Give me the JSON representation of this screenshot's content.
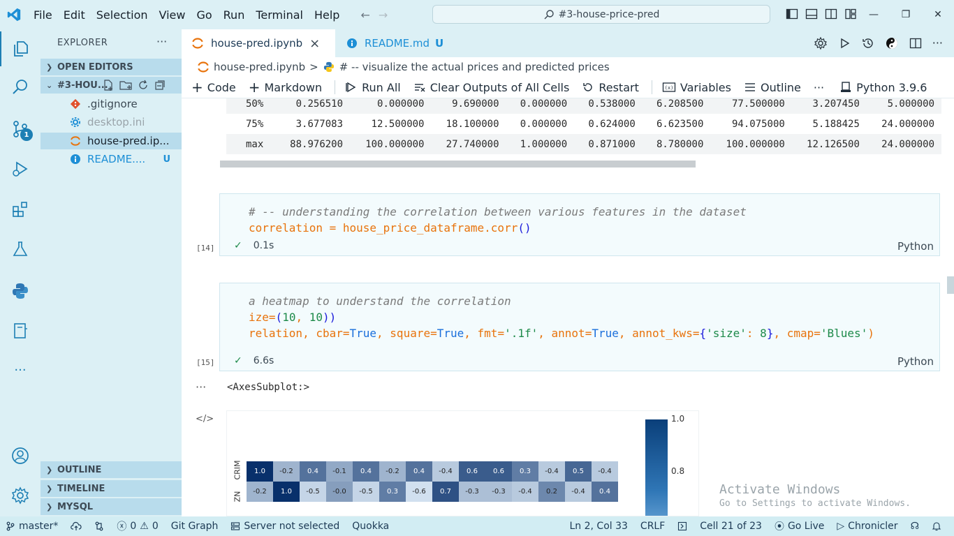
{
  "window": {
    "menu": [
      "File",
      "Edit",
      "Selection",
      "View",
      "Go",
      "Run",
      "Terminal",
      "Help"
    ],
    "search": "#3-house-price-pred"
  },
  "activity": {
    "scm_badge": "1"
  },
  "sidebar": {
    "title": "EXPLORER",
    "open_editors": "OPEN EDITORS",
    "folder": "#3-HOU...",
    "files": [
      {
        "name": ".gitignore",
        "status": ""
      },
      {
        "name": "desktop.ini",
        "status": ""
      },
      {
        "name": "house-pred.ip...",
        "status": ""
      },
      {
        "name": "README....",
        "status": "U"
      }
    ],
    "outline": "OUTLINE",
    "timeline": "TIMELINE",
    "mysql": "MYSQL"
  },
  "tabs": [
    {
      "label": "house-pred.ipynb",
      "close": "×"
    },
    {
      "label": "README.md",
      "status": "U"
    }
  ],
  "breadcrumb": {
    "file": "house-pred.ipynb",
    "sep": ">",
    "symbol": "# -- visualize the actual prices and predicted prices"
  },
  "toolbar": {
    "code": "Code",
    "markdown": "Markdown",
    "run_all": "Run All",
    "clear_outputs": "Clear Outputs of All Cells",
    "restart": "Restart",
    "variables": "Variables",
    "outline": "Outline",
    "more": "···",
    "kernel": "Python 3.9.6"
  },
  "describe_rows": [
    {
      "label": "50%",
      "values": [
        "0.256510",
        "0.000000",
        "9.690000",
        "0.000000",
        "0.538000",
        "6.208500",
        "77.500000",
        "3.207450",
        "5.000000"
      ]
    },
    {
      "label": "75%",
      "values": [
        "3.677083",
        "12.500000",
        "18.100000",
        "0.000000",
        "0.624000",
        "6.623500",
        "94.075000",
        "5.188425",
        "24.000000"
      ]
    },
    {
      "label": "max",
      "values": [
        "88.976200",
        "100.000000",
        "27.740000",
        "1.000000",
        "0.871000",
        "8.780000",
        "100.000000",
        "12.126500",
        "24.000000"
      ]
    }
  ],
  "cell14": {
    "comment": "# -- understanding the correlation between various features in the dataset",
    "line2_var": "correlation",
    "line2_op": " = ",
    "line2_rest": "house_price_dataframe.corr",
    "line2_parens": "()",
    "count": "[14]",
    "time": "0.1s",
    "lang": "Python"
  },
  "cell15": {
    "l1_comment": "a heatmap to understand the correlation",
    "l2_a": "ize",
    "l2_b": "=",
    "l2_c": "(",
    "l2_d": "10",
    "l2_e": ", ",
    "l2_f": "10",
    "l2_g": "))",
    "l3_a": "relation",
    "l3_b": ", ",
    "l3_c": "cbar",
    "l3_d": "=",
    "l3_e": "True",
    "l3_f": ", ",
    "l3_g": "square",
    "l3_h": "=",
    "l3_i": "True",
    "l3_j": ", ",
    "l3_k": "fmt",
    "l3_l": "=",
    "l3_m": "'.1f'",
    "l3_n": ", ",
    "l3_o": "annot",
    "l3_p": "=",
    "l3_q": "True",
    "l3_r": ", ",
    "l3_s": "annot_kws",
    "l3_t": "=",
    "l3_u": "{",
    "l3_v": "'size'",
    "l3_w": ": ",
    "l3_x": "8",
    "l3_y": "}",
    "l3_z": ", ",
    "l3_aa": "cmap",
    "l3_ab": "=",
    "l3_ac": "'Blues'",
    "l3_ad": ")",
    "count": "[15]",
    "time": "6.6s",
    "lang": "Python"
  },
  "output": {
    "dots": "···",
    "text": "<AxesSubplot:>",
    "code_icon": "</>"
  },
  "heatmap": {
    "rows": [
      {
        "label": "CRIM",
        "values": [
          "1.0",
          "-0.2",
          "0.4",
          "-0.1",
          "0.4",
          "-0.2",
          "0.4",
          "-0.4",
          "0.6",
          "0.6",
          "0.3",
          "-0.4",
          "0.5",
          "-0.4"
        ]
      },
      {
        "label": "ZN",
        "values": [
          "-0.2",
          "1.0",
          "-0.5",
          "-0.0",
          "-0.5",
          "0.3",
          "-0.6",
          "0.7",
          "-0.3",
          "-0.3",
          "-0.4",
          "0.2",
          "-0.4",
          "0.4"
        ]
      }
    ],
    "cbar_ticks": [
      "1.0",
      "0.8"
    ]
  },
  "watermark": {
    "line1": "Activate Windows",
    "line2": "Go to Settings to activate Windows."
  },
  "statusbar": {
    "branch": "master*",
    "errors": "0",
    "warnings": "0",
    "git_graph": "Git Graph",
    "server": "Server not selected",
    "quokka": "Quokka",
    "position": "Ln 2, Col 33",
    "eol": "CRLF",
    "cell": "Cell 21 of 23",
    "golive": "Go Live",
    "chronicler": "Chronicler"
  },
  "colors": {
    "accent": "#1d7fb4",
    "chrome": "#dcf0f5",
    "code_keyword": "#e8730c",
    "code_string": "#1d8a4a",
    "code_bracket": "#1a1adb"
  }
}
